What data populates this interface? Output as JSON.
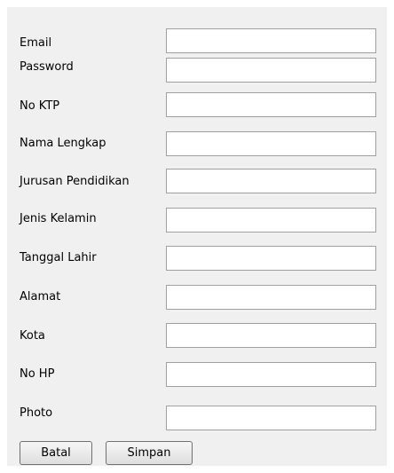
{
  "form": {
    "fields": [
      {
        "label": "Email",
        "value": ""
      },
      {
        "label": "Password",
        "value": ""
      },
      {
        "label": "No KTP",
        "value": ""
      },
      {
        "label": "Nama Lengkap",
        "value": ""
      },
      {
        "label": "Jurusan Pendidikan",
        "value": ""
      },
      {
        "label": "Jenis Kelamin",
        "value": ""
      },
      {
        "label": "Tanggal Lahir",
        "value": ""
      },
      {
        "label": "Alamat",
        "value": ""
      },
      {
        "label": "Kota",
        "value": ""
      },
      {
        "label": "No HP",
        "value": ""
      },
      {
        "label": "Photo",
        "value": ""
      }
    ],
    "buttons": {
      "cancel_label": "Batal",
      "save_label": "Simpan"
    }
  }
}
